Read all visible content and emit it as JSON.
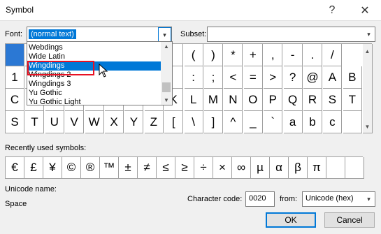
{
  "window": {
    "title": "Symbol",
    "help_icon": "help-icon",
    "close_icon": "close-icon"
  },
  "font": {
    "label": "Font:",
    "value": "(normal text)"
  },
  "subset": {
    "label": "Subset:",
    "value": ""
  },
  "font_dropdown": {
    "items": [
      "Webdings",
      "Wide Latin",
      "Wingdings",
      "Wingdings 2",
      "Wingdings 3",
      "Yu Gothic",
      "Yu Gothic Light"
    ],
    "highlighted": "Wingdings"
  },
  "symbol_grid": {
    "rows": [
      [
        "",
        "",
        "",
        "",
        "",
        "",
        "",
        "",
        "",
        "(",
        ")",
        "*",
        "+",
        ",",
        "-",
        ".",
        "/",
        "0"
      ],
      [
        "1",
        "",
        "",
        "",
        "",
        "",
        "",
        "",
        "",
        ":",
        ";",
        "<",
        "=",
        ">",
        "?",
        "@",
        "A",
        "B"
      ],
      [
        "C",
        "D",
        "E",
        "F",
        "G",
        "H",
        "I",
        "J",
        "K",
        "L",
        "M",
        "N",
        "O",
        "P",
        "Q",
        "R",
        "S",
        "T"
      ],
      [
        "S",
        "T",
        "U",
        "V",
        "W",
        "X",
        "Y",
        "Z",
        "[",
        "\\",
        "]",
        "^",
        "_",
        "`",
        "a",
        "b",
        "c",
        ""
      ]
    ]
  },
  "recently_used": {
    "label": "Recently used symbols:",
    "symbols": [
      "€",
      "£",
      "¥",
      "©",
      "®",
      "™",
      "±",
      "≠",
      "≤",
      "≥",
      "÷",
      "×",
      "∞",
      "µ",
      "α",
      "β",
      "π",
      "",
      "",
      ""
    ]
  },
  "unicode_name": {
    "label": "Unicode name:",
    "value": "Space"
  },
  "character_code": {
    "label": "Character code:",
    "value": "0020"
  },
  "from": {
    "label": "from:",
    "value": "Unicode (hex)"
  },
  "buttons": {
    "ok": "OK",
    "cancel": "Cancel"
  }
}
